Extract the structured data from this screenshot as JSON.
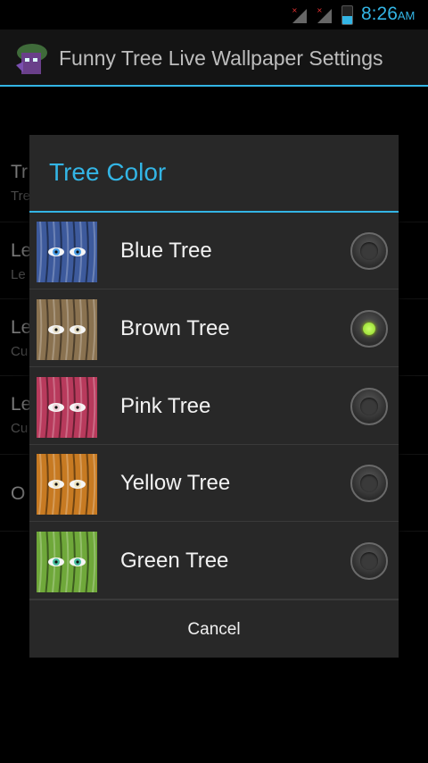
{
  "status_bar": {
    "time": "8:26",
    "ampm": "AM"
  },
  "action_bar": {
    "title": "Funny Tree Live Wallpaper Settings"
  },
  "background_list": [
    {
      "title": "Tr",
      "subtitle": "Tre"
    },
    {
      "title": "Le",
      "subtitle": "Le"
    },
    {
      "title": "Le",
      "subtitle": "Cu"
    },
    {
      "title": "Le",
      "subtitle": "Cu"
    },
    {
      "title": "O",
      "subtitle": ""
    }
  ],
  "dialog": {
    "title": "Tree Color",
    "options": [
      {
        "label": "Blue Tree",
        "color": "#3d5a9c",
        "eye": "#4a9fe8",
        "checked": false
      },
      {
        "label": "Brown Tree",
        "color": "#8a7250",
        "eye": "#e8e0c8",
        "checked": true
      },
      {
        "label": "Pink Tree",
        "color": "#b83a5c",
        "eye": "#f2d0d8",
        "checked": false
      },
      {
        "label": "Yellow Tree",
        "color": "#c77a22",
        "eye": "#f0e6c0",
        "checked": false
      },
      {
        "label": "Green Tree",
        "color": "#6fa83a",
        "eye": "#48c0a0",
        "checked": false
      }
    ],
    "cancel_label": "Cancel"
  },
  "colors": {
    "accent": "#33b5e5",
    "radio_checked": "#99cc00"
  }
}
